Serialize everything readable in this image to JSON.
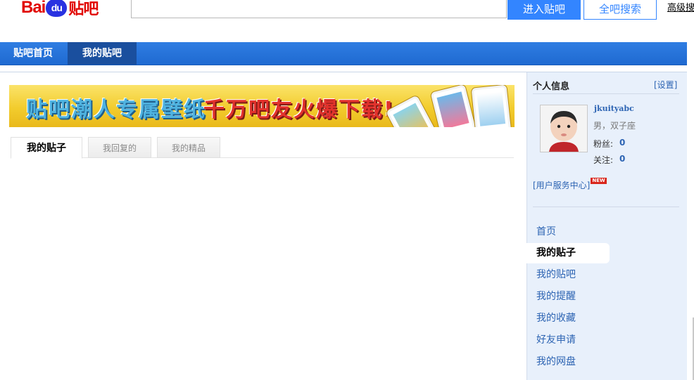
{
  "header": {
    "logo_bai": "Bai",
    "logo_du": "du",
    "logo_tieba": "贴吧",
    "search_value": "",
    "enter_button": "进入贴吧",
    "search_all_button": "全吧搜索",
    "advanced_link": "高级搜"
  },
  "nav": {
    "items": [
      {
        "label": "贴吧首页"
      },
      {
        "label": "我的贴吧"
      }
    ],
    "active": "我的贴吧"
  },
  "banner": {
    "text1": "贴吧潮人专属壁纸",
    "text2": "千万吧友火爆下载!",
    "colors": {
      "bg": "#f2cc2d",
      "text1": "#4fb3e0",
      "text2": "#e2322c"
    }
  },
  "tabs": [
    {
      "label": "我的贴子",
      "active": true
    },
    {
      "label": "我回复的",
      "active": false
    },
    {
      "label": "我的精品",
      "active": false
    }
  ],
  "sidebar": {
    "title": "个人信息",
    "settings_link": "[设置]",
    "username": "jkuityabc",
    "userinfo": "男，双子座",
    "fans_label": "粉丝:",
    "fans_value": "0",
    "follow_label": "关注:",
    "follow_value": "0",
    "service_link": "[用户服务中心]",
    "new_badge": "NEW",
    "menu": [
      {
        "label": "首页",
        "active": false
      },
      {
        "label": "我的贴子",
        "active": true
      },
      {
        "label": "我的贴吧",
        "active": false
      },
      {
        "label": "我的提醒",
        "active": false
      },
      {
        "label": "我的收藏",
        "active": false
      },
      {
        "label": "好友申请",
        "active": false
      },
      {
        "label": "我的网盘",
        "active": false
      }
    ]
  },
  "colors": {
    "nav_bg": "#2f7de2",
    "nav_active": "#1a4f9e",
    "primary_button": "#3385ff",
    "link": "#2d64b3",
    "sidebar_bg": "#e8f0fb",
    "logo_red": "#e10602",
    "logo_blue": "#2932e1"
  }
}
